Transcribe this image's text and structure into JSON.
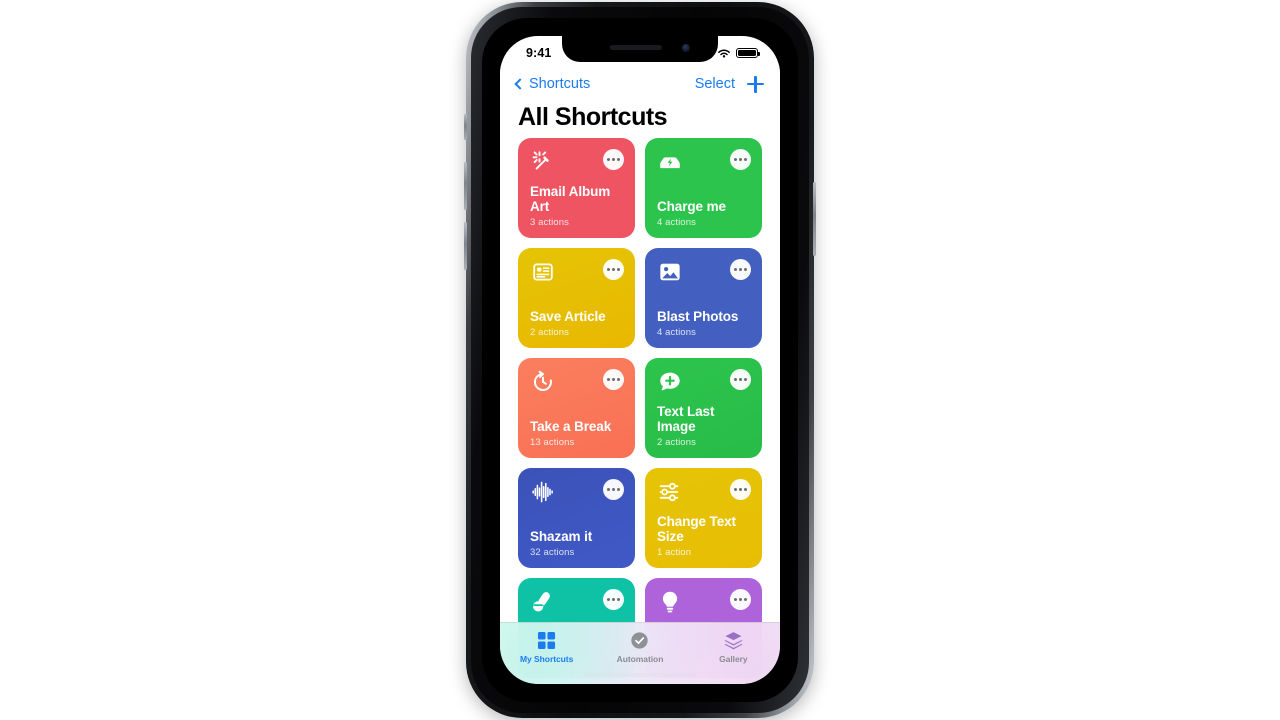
{
  "status_bar": {
    "time": "9:41",
    "signal_icon": "cellular-bars-icon",
    "wifi_icon": "wifi-icon",
    "battery_icon": "battery-full-icon"
  },
  "nav_bar": {
    "back_icon": "chevron-left-icon",
    "back_label": "Shortcuts",
    "select_label": "Select",
    "add_icon": "plus-icon"
  },
  "page_title": "All Shortcuts",
  "shortcuts": [
    {
      "name": "Email Album Art",
      "actions": "3 actions",
      "color": "#EF5463",
      "color2": "#EF5463",
      "icon": "magic-wand-sparkle-icon",
      "more_icon": "ellipsis-icon"
    },
    {
      "name": "Charge me",
      "actions": "4 actions",
      "color": "#2DC44D",
      "color2": "#2DC44D",
      "icon": "car-charging-icon",
      "more_icon": "ellipsis-icon"
    },
    {
      "name": "Save Article",
      "actions": "2 actions",
      "color": "#E5C406",
      "color2": "#E8B800",
      "icon": "news-article-icon",
      "more_icon": "ellipsis-icon"
    },
    {
      "name": "Blast Photos",
      "actions": "4 actions",
      "color": "#4360C0",
      "color2": "#4360C0",
      "icon": "photo-icon",
      "more_icon": "ellipsis-icon"
    },
    {
      "name": "Take a Break",
      "actions": "13 actions",
      "color": "#FA7F5F",
      "color2": "#F97055",
      "icon": "timer-icon",
      "more_icon": "ellipsis-icon"
    },
    {
      "name": "Text Last Image",
      "actions": "2 actions",
      "color": "#2DC44D",
      "color2": "#27BC48",
      "icon": "message-plus-icon",
      "more_icon": "ellipsis-icon"
    },
    {
      "name": "Shazam it",
      "actions": "32 actions",
      "color": "#3B52B8",
      "color2": "#4059C6",
      "icon": "audio-waveform-icon",
      "more_icon": "ellipsis-icon"
    },
    {
      "name": "Change Text Size",
      "actions": "1 action",
      "color": "#E5C406",
      "color2": "#E8BE05",
      "icon": "sliders-icon",
      "more_icon": "ellipsis-icon"
    },
    {
      "name": "",
      "actions": "",
      "color": "#10C2A5",
      "color2": "#10C2A5",
      "icon": "pills-icon",
      "more_icon": "ellipsis-icon"
    },
    {
      "name": "",
      "actions": "",
      "color": "#AE63DB",
      "color2": "#AE63DB",
      "icon": "lightbulb-icon",
      "more_icon": "ellipsis-icon"
    }
  ],
  "tab_bar": {
    "tabs": [
      {
        "label": "My Shortcuts",
        "icon": "grid-squares-icon",
        "active": true
      },
      {
        "label": "Automation",
        "icon": "clock-check-icon",
        "active": false
      },
      {
        "label": "Gallery",
        "icon": "layers-icon",
        "active": false
      }
    ]
  },
  "colors": {
    "accent_blue": "#1b7cf0",
    "inactive_gray": "#8b8b93",
    "automation_icon": "#8e9196",
    "gallery_icon": "#9b6fc4"
  }
}
